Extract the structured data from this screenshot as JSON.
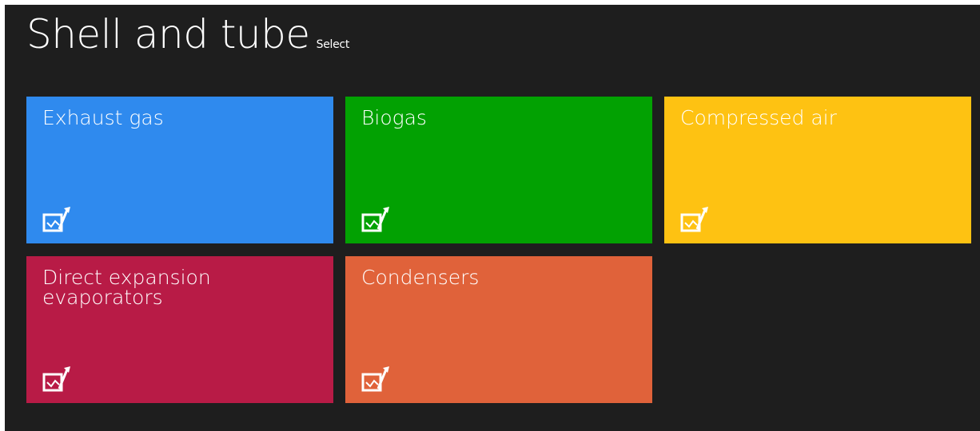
{
  "header": {
    "title": "Shell and tube",
    "subtitle": "Select"
  },
  "tiles": [
    {
      "label": "Exhaust gas",
      "color": "#2f8aee",
      "icon": "chart-select-icon"
    },
    {
      "label": "Biogas",
      "color": "#02a102",
      "icon": "chart-select-icon"
    },
    {
      "label": "Compressed air",
      "color": "#fec212",
      "icon": "chart-select-icon"
    },
    {
      "label": "Direct expansion evaporators",
      "color": "#b81b46",
      "icon": "chart-select-icon"
    },
    {
      "label": "Condensers",
      "color": "#e0623a",
      "icon": "chart-select-icon"
    }
  ]
}
